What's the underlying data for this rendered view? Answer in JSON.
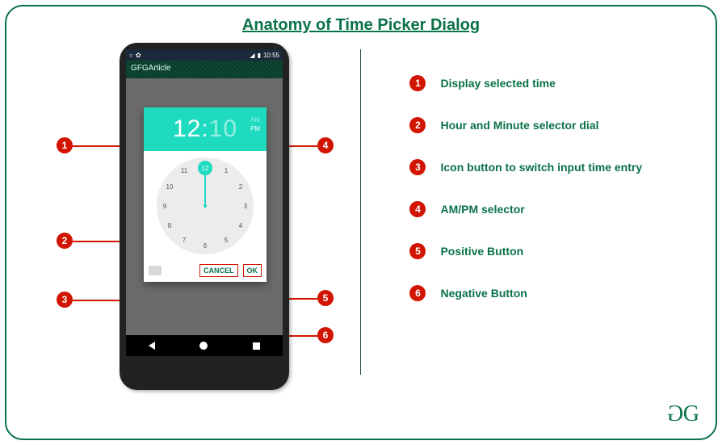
{
  "title": "Anatomy of Time Picker Dialog",
  "phone": {
    "status_time": "10:55",
    "app_title": "GFGArticle",
    "dialog": {
      "hour": "12",
      "minute": "10",
      "am": "AM",
      "pm": "PM",
      "clock_selected": "12",
      "cancel": "CANCEL",
      "ok": "OK",
      "numbers": [
        "12",
        "1",
        "2",
        "3",
        "4",
        "5",
        "6",
        "7",
        "8",
        "9",
        "10",
        "11"
      ]
    },
    "nav": {
      "back": "back",
      "home": "home",
      "recent": "recent"
    }
  },
  "callouts": {
    "1": "Display selected time",
    "2": "Hour and Minute selector dial",
    "3": "Icon button to switch input time entry",
    "4": "AM/PM selector",
    "5": "Positive Button",
    "6": "Negative Button"
  },
  "logo": "GG"
}
